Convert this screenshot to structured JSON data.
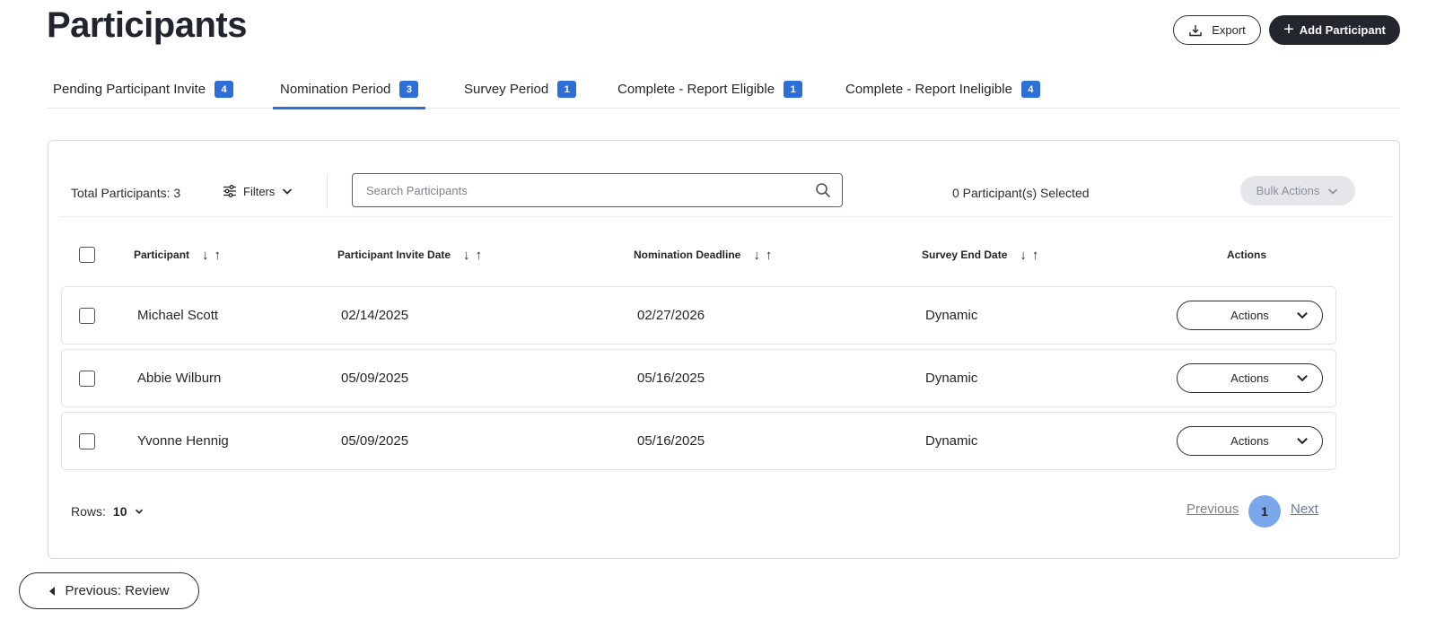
{
  "page": {
    "title": "Participants"
  },
  "header": {
    "export_label": "Export",
    "add_label": "Add Participant"
  },
  "tabs": [
    {
      "label": "Pending Participant Invite",
      "count": "4",
      "active": false
    },
    {
      "label": "Nomination Period",
      "count": "3",
      "active": true
    },
    {
      "label": "Survey Period",
      "count": "1",
      "active": false
    },
    {
      "label": "Complete - Report Eligible",
      "count": "1",
      "active": false
    },
    {
      "label": "Complete - Report Ineligible",
      "count": "4",
      "active": false
    }
  ],
  "toolbar": {
    "total": "Total Participants: 3",
    "filters_label": "Filters",
    "search_placeholder": "Search Participants",
    "selected": "0 Participant(s) Selected",
    "bulk_label": "Bulk Actions"
  },
  "table": {
    "columns": [
      "Participant",
      "Participant Invite Date",
      "Nomination Deadline",
      "Survey End Date",
      "Actions"
    ],
    "rows": [
      {
        "participant": "Michael Scott",
        "invite_date": "02/14/2025",
        "nomination_deadline": "02/27/2026",
        "survey_end": "Dynamic",
        "action_label": "Actions"
      },
      {
        "participant": "Abbie Wilburn",
        "invite_date": "05/09/2025",
        "nomination_deadline": "05/16/2025",
        "survey_end": "Dynamic",
        "action_label": "Actions"
      },
      {
        "participant": "Yvonne Hennig",
        "invite_date": "05/09/2025",
        "nomination_deadline": "05/16/2025",
        "survey_end": "Dynamic",
        "action_label": "Actions"
      }
    ]
  },
  "pagination": {
    "rows_label": "Rows:",
    "rows_value": "10",
    "prev_label": "Previous",
    "current_page": "1",
    "next_label": "Next"
  },
  "footer": {
    "back_label": "Previous: Review"
  },
  "colors": {
    "accent": "#2d6fd6",
    "dark_button": "#23262d",
    "page_active": "#7aa6ea",
    "disabled_bg": "#e4e6ea"
  },
  "icons": [
    "download-icon",
    "plus-icon",
    "sliders-icon",
    "chevron-down-icon",
    "search-icon",
    "arrow-down-icon",
    "arrow-up-icon",
    "caret-left-icon"
  ]
}
